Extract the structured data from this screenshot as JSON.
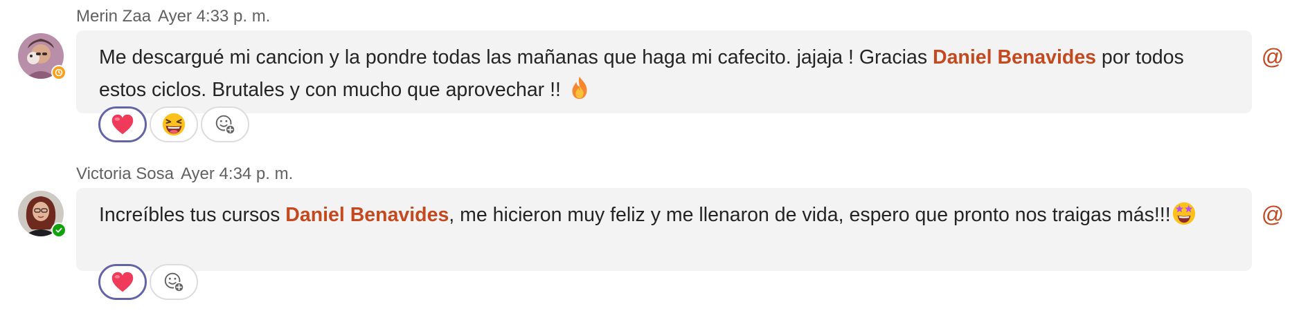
{
  "messages": [
    {
      "author": "Merin Zaa",
      "timestamp": "Ayer 4:33 p. m.",
      "status": "away",
      "text_before": "Me descargué mi cancion y la pondre todas las mañanas que haga mi cafecito. jajaja ! Gracias ",
      "mention": "Daniel Benavides",
      "text_after": " por todos estos ciclos. Brutales y con mucho que aprovechar !! ",
      "inline_emoji": "fire-emoji",
      "reactions": [
        "heart-emoji",
        "laughing-emoji"
      ],
      "at_label": "@"
    },
    {
      "author": "Victoria Sosa",
      "timestamp": "Ayer 4:34 p. m.",
      "status": "available",
      "text_before": "Increíbles tus cursos ",
      "mention": "Daniel Benavides",
      "text_after": ", me hicieron muy feliz y me llenaron de vida, espero que pronto nos traigas más!!!",
      "inline_emoji": "star-struck-emoji",
      "reactions": [
        "heart-emoji"
      ],
      "at_label": "@"
    }
  ],
  "colors": {
    "mention": "#c4491f",
    "bubble_bg": "#f3f3f3",
    "selected_reaction_border": "#6264a7",
    "status_away": "#f8a01d",
    "status_available": "#13a10e"
  }
}
